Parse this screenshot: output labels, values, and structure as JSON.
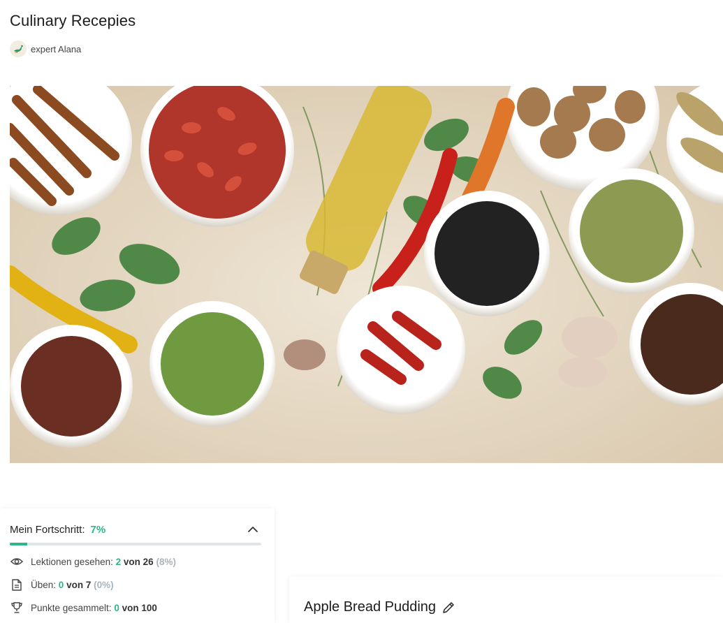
{
  "course": {
    "title": "Culinary Recepies",
    "author": "expert Alana"
  },
  "hero": {
    "alt": "spices-hero-image"
  },
  "progress": {
    "label": "Mein Fortschritt:",
    "percent_text": "7%",
    "percent_value": 7,
    "lessons": {
      "label": "Lektionen gesehen:",
      "done": "2",
      "of": "von 26",
      "pct": "(8%)"
    },
    "practice": {
      "label": "Üben:",
      "done": "0",
      "of": "von 7",
      "pct": "(0%)"
    },
    "points": {
      "label": "Punkte gesammelt:",
      "done": "0",
      "of": "von 100"
    }
  },
  "lesson": {
    "title": "Apple Bread Pudding"
  },
  "colors": {
    "accent": "#2fb58a",
    "muted": "#aab4bd"
  },
  "icons": {
    "collapse": "chevron-up-icon",
    "lessons": "eye-icon",
    "practice": "document-icon",
    "points": "trophy-icon",
    "edit": "pencil-icon"
  }
}
